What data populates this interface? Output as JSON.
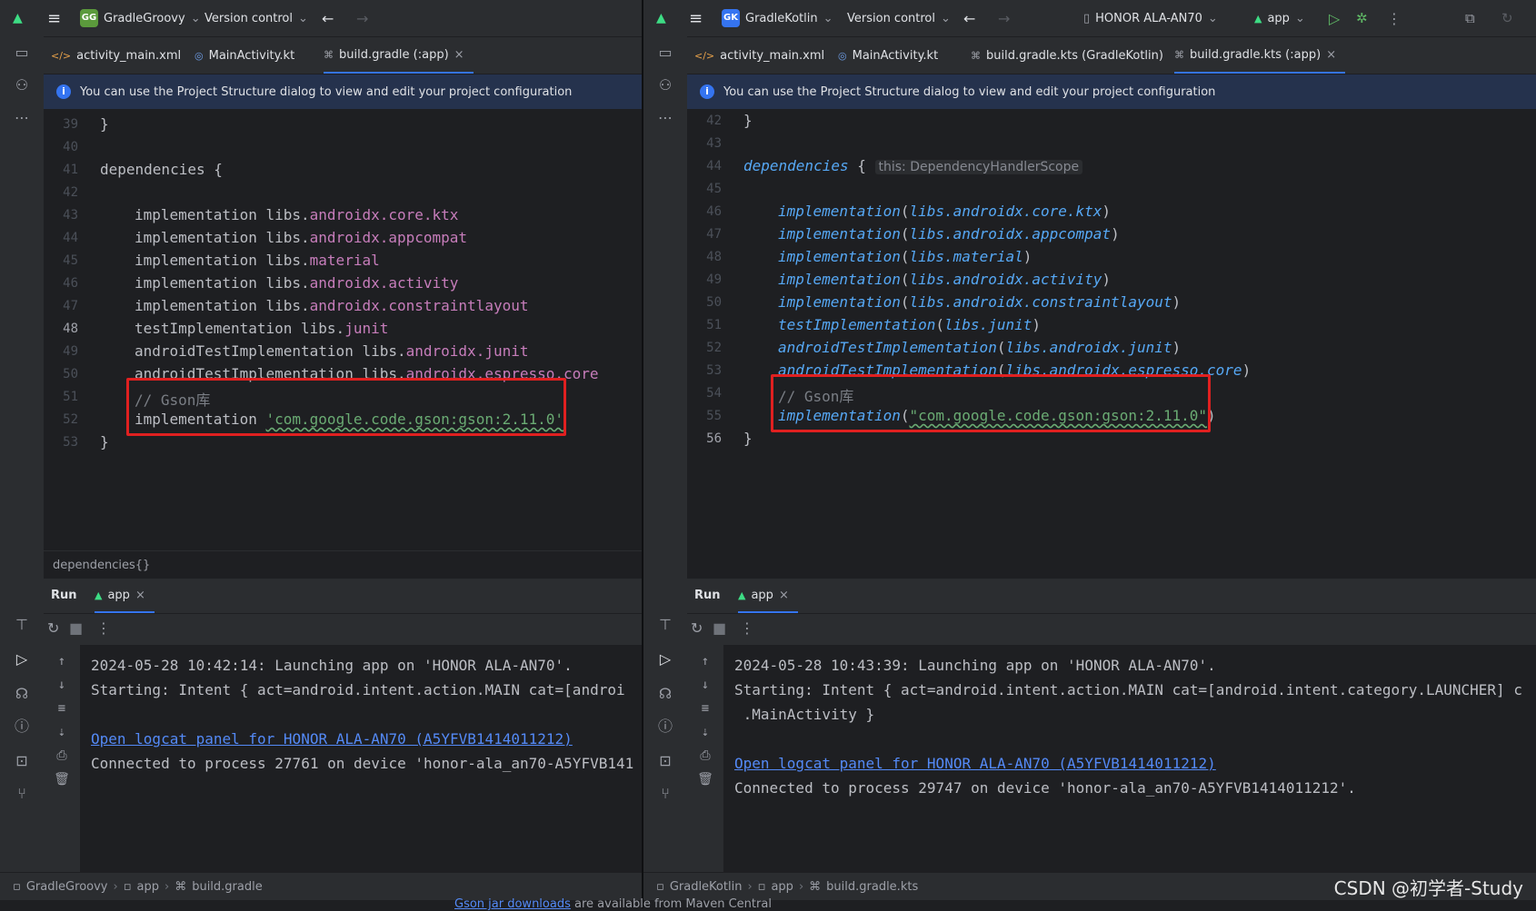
{
  "left": {
    "project": "GradleGroovy",
    "project_badge": "GG",
    "vcs": "Version control",
    "tabs": [
      {
        "label": "activity_main.xml",
        "icon": "xml-icon",
        "active": false
      },
      {
        "label": "MainActivity.kt",
        "icon": "kotlin-icon",
        "active": false
      },
      {
        "label": "build.gradle (:app)",
        "icon": "gradle-icon",
        "active": true
      }
    ],
    "banner": "You can use the Project Structure dialog to view and edit your project configuration",
    "lines": [
      {
        "n": "39",
        "text": "}"
      },
      {
        "n": "40",
        "text": ""
      },
      {
        "n": "41",
        "text": "dependencies {"
      },
      {
        "n": "42",
        "text": ""
      },
      {
        "n": "43",
        "kw": "implementation libs.",
        "acc": "androidx.core.ktx"
      },
      {
        "n": "44",
        "kw": "implementation libs.",
        "acc": "androidx.appcompat"
      },
      {
        "n": "45",
        "kw": "implementation libs.",
        "acc": "material"
      },
      {
        "n": "46",
        "kw": "implementation libs.",
        "acc": "androidx.activity"
      },
      {
        "n": "47",
        "kw": "implementation libs.",
        "acc": "androidx.constraintlayout"
      },
      {
        "n": "48",
        "kw": "testImplementation libs.",
        "acc": "junit"
      },
      {
        "n": "49",
        "kw": "androidTestImplementation libs.",
        "acc": "androidx.junit"
      },
      {
        "n": "50",
        "kw": "androidTestImplementation libs.",
        "acc": "androidx.espresso.core"
      },
      {
        "n": "51",
        "comment": "// Gson库"
      },
      {
        "n": "52",
        "kw": "implementation ",
        "str": "'com.google.code.gson:gson:2.11.0'"
      },
      {
        "n": "53",
        "text": "}"
      }
    ],
    "current_line": "48",
    "breadcrumb": "dependencies{}",
    "run_label": "Run",
    "run_tab": "app",
    "console": {
      "line1": "2024-05-28 10:42:14: Launching app on 'HONOR ALA-AN70'.",
      "line2": "Starting: Intent { act=android.intent.action.MAIN cat=[androi",
      "link": "Open logcat panel for HONOR ALA-AN70 (A5YFVB1414011212)",
      "line4": "Connected to process 27761 on device 'honor-ala_an70-A5YFVB141"
    },
    "status": [
      "GradleGroovy",
      "app",
      "build.gradle"
    ]
  },
  "right": {
    "project": "GradleKotlin",
    "project_badge": "GK",
    "vcs": "Version control",
    "device": "HONOR ALA-AN70",
    "run_config": "app",
    "tabs": [
      {
        "label": "activity_main.xml",
        "icon": "xml-icon",
        "active": false
      },
      {
        "label": "MainActivity.kt",
        "icon": "kotlin-icon",
        "active": false
      },
      {
        "label": "build.gradle.kts (GradleKotlin)",
        "icon": "gradle-icon",
        "active": false
      },
      {
        "label": "build.gradle.kts (:app)",
        "icon": "gradle-icon",
        "active": true
      }
    ],
    "banner": "You can use the Project Structure dialog to view and edit your project configuration",
    "hint": "this: DependencyHandlerScope",
    "lines": [
      {
        "n": "42",
        "text": "}"
      },
      {
        "n": "43",
        "text": ""
      },
      {
        "n": "44",
        "fn": "dependencies",
        "rest": " {"
      },
      {
        "n": "45",
        "text": ""
      },
      {
        "n": "46",
        "fn": "implementation",
        "args": "libs.androidx.core.ktx"
      },
      {
        "n": "47",
        "fn": "implementation",
        "args": "libs.androidx.appcompat"
      },
      {
        "n": "48",
        "fn": "implementation",
        "args": "libs.material"
      },
      {
        "n": "49",
        "fn": "implementation",
        "args": "libs.androidx.activity"
      },
      {
        "n": "50",
        "fn": "implementation",
        "args": "libs.androidx.constraintlayout"
      },
      {
        "n": "51",
        "fn": "testImplementation",
        "args": "libs.junit"
      },
      {
        "n": "52",
        "fn": "androidTestImplementation",
        "args": "libs.androidx.junit"
      },
      {
        "n": "53",
        "fn": "androidTestImplementation",
        "args": "libs.androidx.espresso.core"
      },
      {
        "n": "54",
        "comment": "// Gson库"
      },
      {
        "n": "55",
        "fn": "implementation",
        "str": "\"com.google.code.gson:gson:2.11.0\""
      },
      {
        "n": "56",
        "text": "}"
      }
    ],
    "current_line": "56",
    "run_label": "Run",
    "run_tab": "app",
    "console": {
      "line1": "2024-05-28 10:43:39: Launching app on 'HONOR ALA-AN70'.",
      "line2": "Starting: Intent { act=android.intent.action.MAIN cat=[android.intent.category.LAUNCHER] c",
      "line3": " .MainActivity }",
      "link": "Open logcat panel for HONOR ALA-AN70 (A5YFVB1414011212)",
      "line5": "Connected to process 29747 on device 'honor-ala_an70-A5YFVB1414011212'."
    },
    "status": [
      "GradleKotlin",
      "app",
      "build.gradle.kts"
    ]
  },
  "footer": {
    "link": "Gson jar downloads",
    "rest": " are available from Maven Central"
  },
  "watermark": "CSDN @初学者-Study",
  "colors": {
    "accent": "#3574f0",
    "highlight_box": "#e02020",
    "keyword_purple": "#c77dbb",
    "function_blue": "#56a8f5",
    "string_green": "#6aab73"
  }
}
